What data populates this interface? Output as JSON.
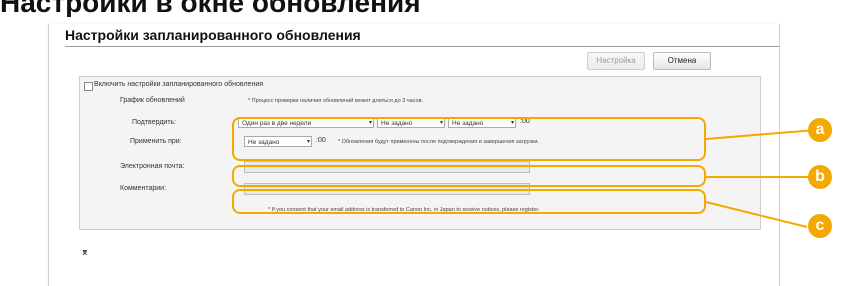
{
  "document_heading": "Настройки в окне обновления",
  "title": "Настройки запланированного обновления",
  "buttons": {
    "apply": "Настройка",
    "cancel": "Отмена"
  },
  "enable_checkbox_label": "Включить настройки запланированного обновления",
  "schedule": {
    "label": "График обновлений",
    "note": "* Процесс проверки наличия обновлений может длиться до 3 часов.",
    "confirm": {
      "label": "Подтвердить:",
      "frequency": "Один раз в две недели",
      "day": "Не задано",
      "hour": "Не задано",
      "minutes_suffix": ":00"
    },
    "apply_at": {
      "label": "Применить при:",
      "hour": "Не задано",
      "minutes_suffix": ":00",
      "note": "* Обновления будут применены после подтверждения и завершения загрузки."
    }
  },
  "email": {
    "label": "Электронная почта:",
    "value": ""
  },
  "comments": {
    "label": "Комментарии:",
    "value": ""
  },
  "consent_note": "* If you consent that your email address is transferred to Canon Inc. in Japan to receive notices, please register.",
  "pin_icon": "⌆",
  "callouts": [
    "a",
    "b",
    "c"
  ],
  "colors": {
    "accent": "#f5a800",
    "panel_bg": "#f4f4f4"
  }
}
